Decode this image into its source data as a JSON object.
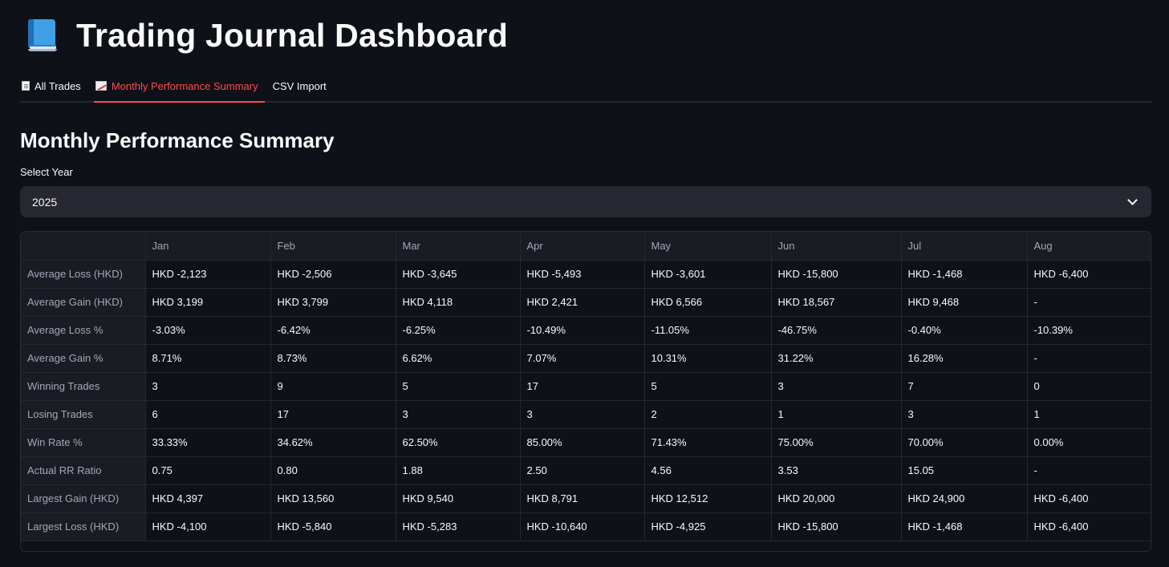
{
  "header": {
    "title": "Trading Journal Dashboard"
  },
  "tabs": [
    {
      "label": "All Trades",
      "icon": "document-icon",
      "active": false
    },
    {
      "label": "Monthly Performance Summary",
      "icon": "chart-increasing-icon",
      "active": true
    },
    {
      "label": "CSV Import",
      "icon": "",
      "active": false
    }
  ],
  "section": {
    "title": "Monthly Performance Summary",
    "select_label": "Select Year",
    "select_value": "2025"
  },
  "table": {
    "columns": [
      "",
      "Jan",
      "Feb",
      "Mar",
      "Apr",
      "May",
      "Jun",
      "Jul",
      "Aug"
    ],
    "rows": [
      [
        "Average Loss (HKD)",
        "HKD -2,123",
        "HKD -2,506",
        "HKD -3,645",
        "HKD -5,493",
        "HKD -3,601",
        "HKD -15,800",
        "HKD -1,468",
        "HKD -6,400"
      ],
      [
        "Average Gain (HKD)",
        "HKD 3,199",
        "HKD 3,799",
        "HKD 4,118",
        "HKD 2,421",
        "HKD 6,566",
        "HKD 18,567",
        "HKD 9,468",
        "-"
      ],
      [
        "Average Loss %",
        "-3.03%",
        "-6.42%",
        "-6.25%",
        "-10.49%",
        "-11.05%",
        "-46.75%",
        "-0.40%",
        "-10.39%"
      ],
      [
        "Average Gain %",
        "8.71%",
        "8.73%",
        "6.62%",
        "7.07%",
        "10.31%",
        "31.22%",
        "16.28%",
        "-"
      ],
      [
        "Winning Trades",
        "3",
        "9",
        "5",
        "17",
        "5",
        "3",
        "7",
        "0"
      ],
      [
        "Losing Trades",
        "6",
        "17",
        "3",
        "3",
        "2",
        "1",
        "3",
        "1"
      ],
      [
        "Win Rate %",
        "33.33%",
        "34.62%",
        "62.50%",
        "85.00%",
        "71.43%",
        "75.00%",
        "70.00%",
        "0.00%"
      ],
      [
        "Actual RR Ratio",
        "0.75",
        "0.80",
        "1.88",
        "2.50",
        "4.56",
        "3.53",
        "15.05",
        "-"
      ],
      [
        "Largest Gain (HKD)",
        "HKD 4,397",
        "HKD 13,560",
        "HKD 9,540",
        "HKD 8,791",
        "HKD 12,512",
        "HKD 20,000",
        "HKD 24,900",
        "HKD -6,400"
      ],
      [
        "Largest Loss (HKD)",
        "HKD -4,100",
        "HKD -5,840",
        "HKD -5,283",
        "HKD -10,640",
        "HKD -4,925",
        "HKD -15,800",
        "HKD -1,468",
        "HKD -6,400"
      ]
    ]
  },
  "colors": {
    "background": "#0e1117",
    "accent": "#ff4b4b",
    "input_bg": "#262730"
  }
}
